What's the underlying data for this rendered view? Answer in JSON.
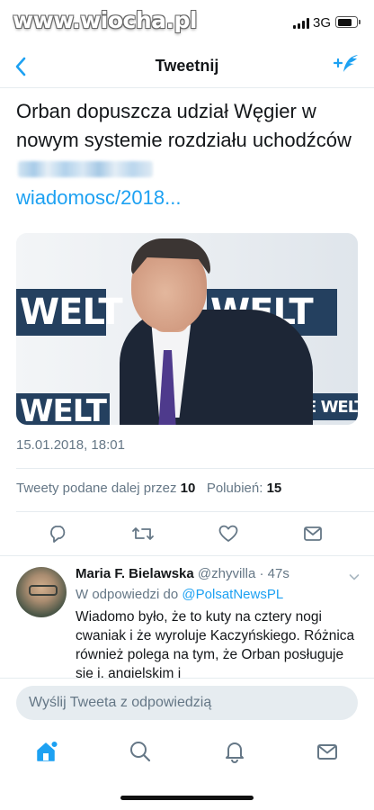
{
  "status_bar": {
    "watermark": "www.wiocha.pl",
    "network": "3G",
    "signal_bars": 4,
    "battery_level": 0.8
  },
  "nav": {
    "title": "Tweetnij",
    "back_icon": "chevron-left-icon",
    "compose_icon": "compose-tweet-icon"
  },
  "tweet": {
    "text": "Orban dopuszcza udział Węgier w nowym systemie rozdziału uchodźców",
    "link": "wiadomosc/2018...",
    "media_labels": [
      "WELT",
      "WELT",
      "WELT",
      "E WELT"
    ],
    "timestamp": "15.01.2018, 18:01",
    "retweets_label": "Tweety podane dalej przez",
    "retweets_count": "10",
    "likes_label": "Polubień:",
    "likes_count": "15",
    "actions": [
      "reply-icon",
      "retweet-icon",
      "like-icon",
      "share-icon"
    ]
  },
  "reply": {
    "name": "Maria F. Bielawska",
    "handle": "@zhyvilla · 47s",
    "in_reply_to_label": "W odpowiedzi do",
    "in_reply_to_handle": "@PolsatNewsPL",
    "text": "Wiadomo było, że to kuty na cztery nogi cwaniak i że wyroluje Kaczyńskiego. Różnica również polega na tym, że Orban posługuje się i. angielskim i"
  },
  "composer": {
    "placeholder": "Wyślij Tweeta z odpowiedzią"
  },
  "tabbar": {
    "items": [
      "home-icon",
      "search-icon",
      "notifications-icon",
      "messages-icon"
    ],
    "active": "home-icon"
  },
  "colors": {
    "accent": "#1da1f2",
    "secondary_text": "#657786",
    "divider": "#e6ecf0"
  }
}
